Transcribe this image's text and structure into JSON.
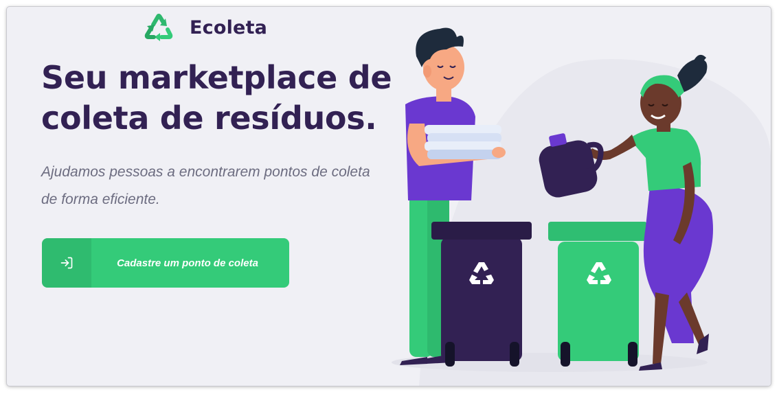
{
  "brand": {
    "name": "Ecoleta",
    "logo_icon": "recycle-icon",
    "accent_color": "#34CB79",
    "title_color": "#322153",
    "text_color": "#6C6C80",
    "background_color": "#F0F0F5"
  },
  "hero": {
    "headline_line1": "Seu marketplace de",
    "headline_line2": "coleta de resíduos.",
    "subtitle_line1": "Ajudamos pessoas a encontrarem pontos de coleta",
    "subtitle_line2": "de forma eficiente."
  },
  "cta": {
    "label": "Cadastre um ponto de coleta",
    "icon": "log-in-icon"
  },
  "illustration": {
    "bin_icon": "recycle-icon",
    "bin_colors": [
      "#322153",
      "#34CB79"
    ]
  }
}
